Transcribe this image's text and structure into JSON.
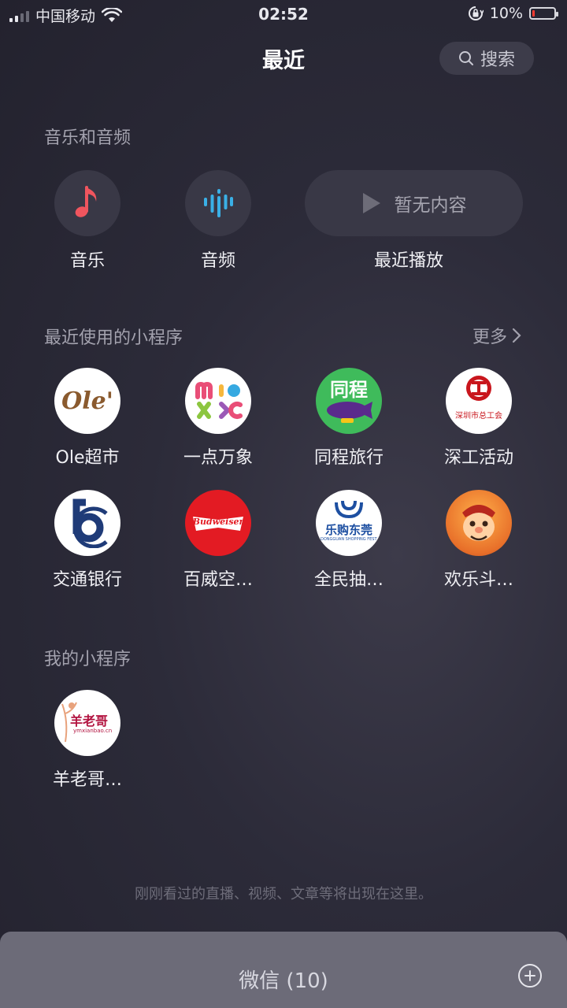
{
  "status_bar": {
    "carrier": "中国移动",
    "time": "02:52",
    "battery_percent": "10%",
    "battery_level": 0.1,
    "icons": [
      "signal-icon",
      "wifi-icon",
      "orientation-lock-icon",
      "battery-icon"
    ]
  },
  "header": {
    "title": "最近",
    "search_label": "搜索"
  },
  "music_section": {
    "title": "音乐和音频",
    "music_label": "音乐",
    "audio_label": "音频",
    "recent_empty": "暂无内容",
    "recent_play_label": "最近播放",
    "colors": {
      "music_note": "#f0555e",
      "audio_wave": "#3ab0e6"
    }
  },
  "recent_programs": {
    "title": "最近使用的小程序",
    "more_label": "更多",
    "items": [
      {
        "label": "Ole超市",
        "logo_text": "Ole'",
        "icon": "ole-logo"
      },
      {
        "label": "一点万象",
        "logo_text": "mixc",
        "icon": "mixc-logo"
      },
      {
        "label": "同程旅行",
        "logo_text": "同程",
        "icon": "tongcheng-logo"
      },
      {
        "label": "深工活动",
        "logo_text": "深圳市总工会",
        "icon": "shengong-logo"
      },
      {
        "label": "交通银行",
        "logo_text": "",
        "icon": "bocom-logo"
      },
      {
        "label": "百威空…",
        "logo_text": "Budweiser",
        "icon": "budweiser-logo"
      },
      {
        "label": "全民抽…",
        "logo_text": "乐购东莞",
        "logo_subtext": "DONGGUAN SHOPPING FESTIVAL",
        "icon": "legou-logo"
      },
      {
        "label": "欢乐斗…",
        "logo_text": "",
        "icon": "huanle-logo"
      }
    ]
  },
  "my_programs": {
    "title": "我的小程序",
    "items": [
      {
        "label": "羊老哥…",
        "logo_text": "羊老哥",
        "logo_subtext": "ymxianbao.cn",
        "icon": "yanglaoge-logo"
      }
    ]
  },
  "footer": {
    "hint": "刚刚看过的直播、视频、文章等将出现在这里。"
  },
  "bottom_bar": {
    "title": "微信 (10)"
  }
}
